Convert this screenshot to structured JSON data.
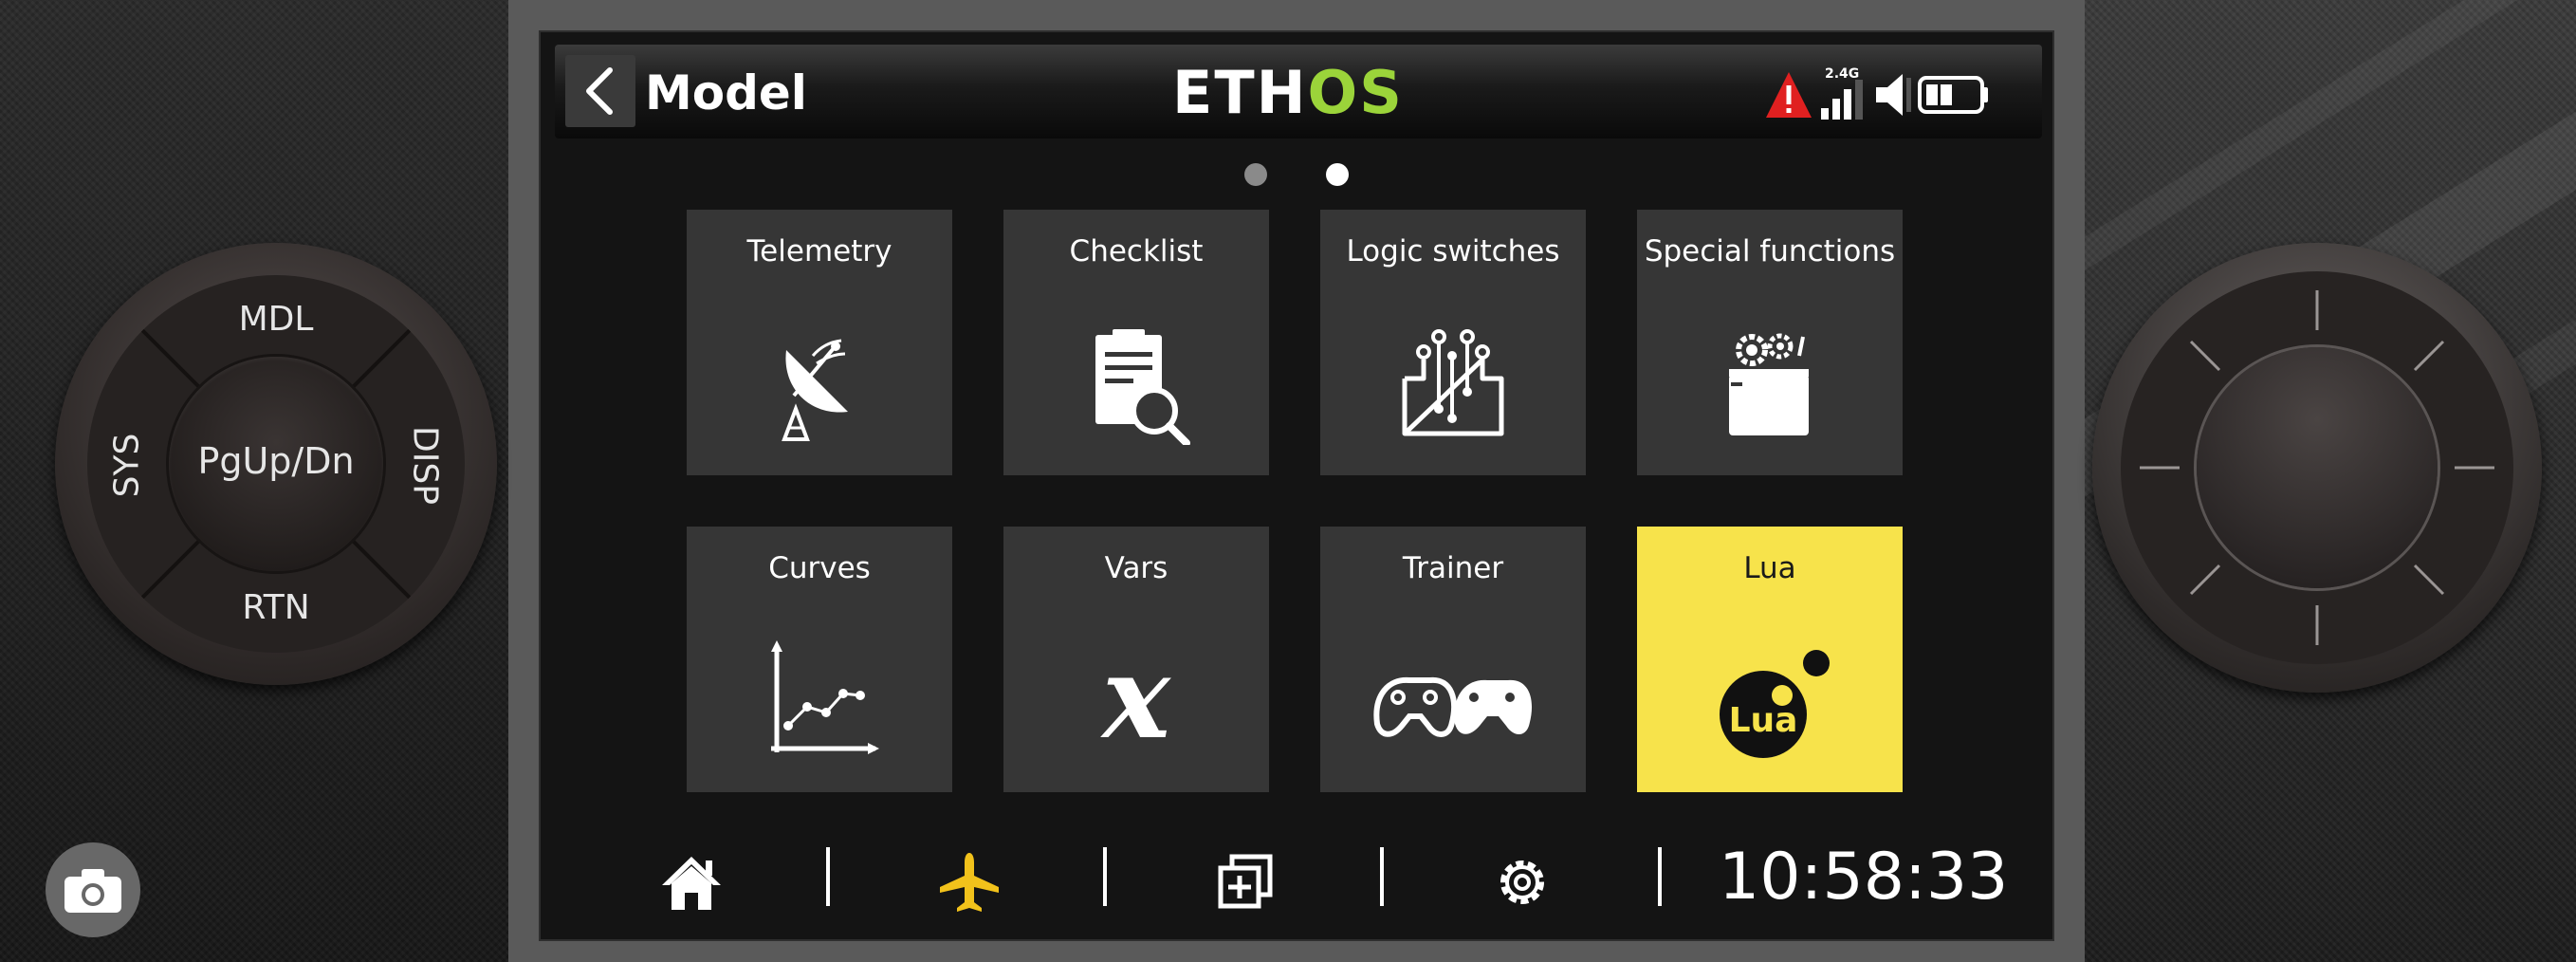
{
  "header": {
    "title": "Model",
    "brand_part1": "ETH",
    "brand_part2": "OS",
    "status": {
      "radio_band": "2.4G"
    }
  },
  "pager": {
    "pages": 2,
    "current_page": 2
  },
  "tiles": [
    {
      "label": "Telemetry",
      "icon": "satellite-dish-icon"
    },
    {
      "label": "Checklist",
      "icon": "checklist-icon"
    },
    {
      "label": "Logic switches",
      "icon": "logic-circuit-icon"
    },
    {
      "label": "Special functions",
      "icon": "gears-icon"
    },
    {
      "label": "Curves",
      "icon": "curve-graph-icon"
    },
    {
      "label": "Vars",
      "icon": "variable-x-icon"
    },
    {
      "label": "Trainer",
      "icon": "gamepads-icon"
    },
    {
      "label": "Lua",
      "icon": "lua-logo-icon",
      "selected": true
    }
  ],
  "lua_logo_text": "Lua",
  "bottom_bar": {
    "items": [
      "home-icon",
      "airplane-icon",
      "screens-icon",
      "settings-gear-icon"
    ],
    "active": "airplane-icon",
    "clock": "10:58:33"
  },
  "left_dial": {
    "top": "MDL",
    "bottom": "RTN",
    "left": "SYS",
    "right": "DISP",
    "center": "PgUp/Dn"
  },
  "colors": {
    "accent_green": "#9bd43a",
    "selected_tile": "#f7e34b",
    "active_nav": "#f2c21b",
    "warning_red": "#e02020",
    "tile_bg": "#363636"
  }
}
